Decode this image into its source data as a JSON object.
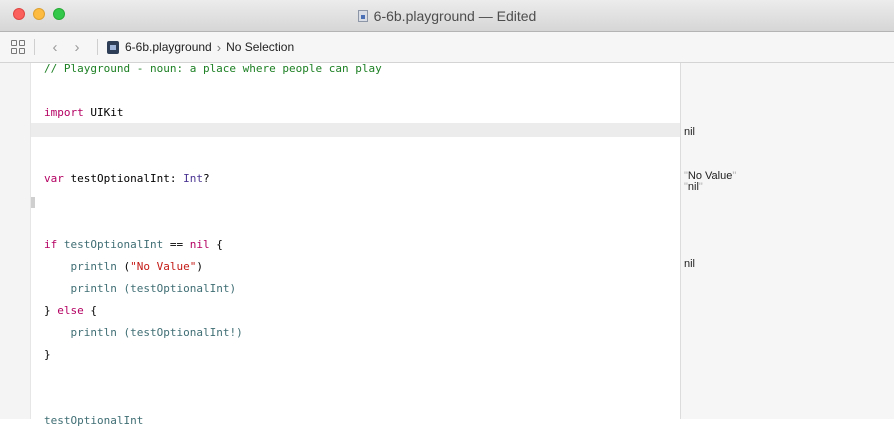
{
  "window": {
    "title": "6-6b.playground — Edited"
  },
  "jumpbar": {
    "file": "6-6b.playground",
    "selection": "No Selection"
  },
  "code": {
    "line1": "// Playground - noun: a place where people can play",
    "line3_kw": "import",
    "line3_mod": "UIKit",
    "line5_kw": "var",
    "line5_name": "testOptionalInt:",
    "line5_type": "Int",
    "line5_q": "?",
    "line7_kw": "if",
    "line7_name": "testOptionalInt",
    "line7_op": "==",
    "line7_nil": "nil",
    "line7_brace": "{",
    "line8_fn": "println",
    "line8_open": "(",
    "line8_str": "\"No Value\"",
    "line8_close": ")",
    "line9_fn": "println",
    "line9_arg": "(testOptionalInt)",
    "line10_brace": "}",
    "line10_kw": "else",
    "line10_brace2": "{",
    "line11_fn": "println",
    "line11_arg": "(testOptionalInt!)",
    "line12": "}",
    "line14": "testOptionalInt"
  },
  "results": {
    "r1": "nil",
    "r2_open": "\"",
    "r2_text": "No Value",
    "r2_close": "\"",
    "r3_open": "\"",
    "r3_text": "nil",
    "r3_close": "\"",
    "r4": "nil"
  }
}
